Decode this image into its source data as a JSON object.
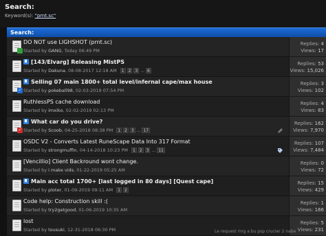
{
  "header": {
    "title": "Search:",
    "keyword_label": "Keyword(s):",
    "keyword_value": "\"prnt.sc\""
  },
  "bar": {
    "label": "Search:"
  },
  "threads": [
    {
      "title": "DO NOT use LIGHSHOT (prnt.sc)",
      "bold": false,
      "prefix": false,
      "started_by": "Started by",
      "author": "GANG",
      "date": "Today 06:49 PM",
      "pages": [],
      "replies_label": "Replies:",
      "replies": "4",
      "views_label": "Views:",
      "views": "17",
      "badge": "green",
      "badge_icon": "new-post"
    },
    {
      "title": "[143/Elvarg] Releasing MistPS",
      "bold": true,
      "prefix": true,
      "started_by": "Started by",
      "author": "Dakuna",
      "date": "08-08-2017 12:18 AM",
      "pages": [
        "1",
        "2",
        "3",
        "...",
        "6"
      ],
      "replies_label": "Replies:",
      "replies": "53",
      "views_label": "Views:",
      "views": "15,026",
      "badge": "",
      "badge_icon": ""
    },
    {
      "title": "Selling 07 main 1800+ total level/infernal cape/max house",
      "bold": true,
      "prefix": true,
      "started_by": "Started by",
      "author": "pokeball98",
      "date": "02-03-2019 07:54 PM",
      "pages": [],
      "replies_label": "Replies:",
      "replies": "3",
      "views_label": "Views:",
      "views": "102",
      "badge": "blue",
      "badge_icon": "check"
    },
    {
      "title": "RuthlessPS cache download",
      "bold": false,
      "prefix": false,
      "started_by": "Started by",
      "author": "imxiko",
      "date": "02-02-2019 02:13 PM",
      "pages": [],
      "replies_label": "Replies:",
      "replies": "4",
      "views_label": "Views:",
      "views": "83",
      "badge": "",
      "badge_icon": ""
    },
    {
      "title": "What car do you drive?",
      "bold": true,
      "prefix": true,
      "started_by": "Started by",
      "author": "Scoob",
      "date": "04-25-2018 08:38 PM",
      "pages": [
        "1",
        "2",
        "3",
        "...",
        "17"
      ],
      "replies_label": "Replies:",
      "replies": "162",
      "views_label": "Views:",
      "views": "7,970",
      "badge": "red",
      "badge_icon": "check",
      "right_icon": "pencil"
    },
    {
      "title": "OSDC V2 - Converts Latest RuneScape Data Into 317 Format",
      "bold": false,
      "prefix": false,
      "started_by": "Started by",
      "author": "strongmuffin",
      "date": "04-14-2018 10:23 PM",
      "pages": [
        "1",
        "2",
        "3",
        "...",
        "11"
      ],
      "replies_label": "Replies:",
      "replies": "107",
      "views_label": "Views:",
      "views": "7,484",
      "badge": "",
      "badge_icon": "",
      "right_icon": "tag"
    },
    {
      "title": "[Vencillio] Client Backround wont change.",
      "bold": false,
      "prefix": false,
      "started_by": "Started by",
      "author": "i make vids",
      "date": "01-22-2019 05:25 AM",
      "pages": [],
      "replies_label": "Replies:",
      "replies": "0",
      "views_label": "Views:",
      "views": "72",
      "badge": "",
      "badge_icon": ""
    },
    {
      "title": "Main acc total 1700+ [last logged in 80 days] [Quest cape]",
      "bold": true,
      "prefix": true,
      "started_by": "Started by",
      "author": "ploter",
      "date": "01-09-2019 09:11 AM",
      "pages": [
        "1",
        "2"
      ],
      "replies_label": "Replies:",
      "replies": "15",
      "views_label": "Views:",
      "views": "429",
      "badge": "",
      "badge_icon": ""
    },
    {
      "title": "Code help: Construction skill :(",
      "bold": false,
      "prefix": false,
      "started_by": "Started by",
      "author": "try2getgood",
      "date": "01-06-2019 10:35 AM",
      "pages": [],
      "replies_label": "Replies:",
      "replies": "1",
      "views_label": "Views:",
      "views": "166",
      "badge": "",
      "badge_icon": ""
    },
    {
      "title": "lost",
      "bold": false,
      "prefix": false,
      "started_by": "Started by",
      "author": "tousuki",
      "date": "12-31-2018 06:30 PM",
      "pages": [],
      "replies_label": "Replies:",
      "replies": "5",
      "views_label": "Views:",
      "views": "231",
      "badge": "",
      "badge_icon": ""
    }
  ],
  "footer_text": "Le request ring a bu psp crucier 2 nabe"
}
